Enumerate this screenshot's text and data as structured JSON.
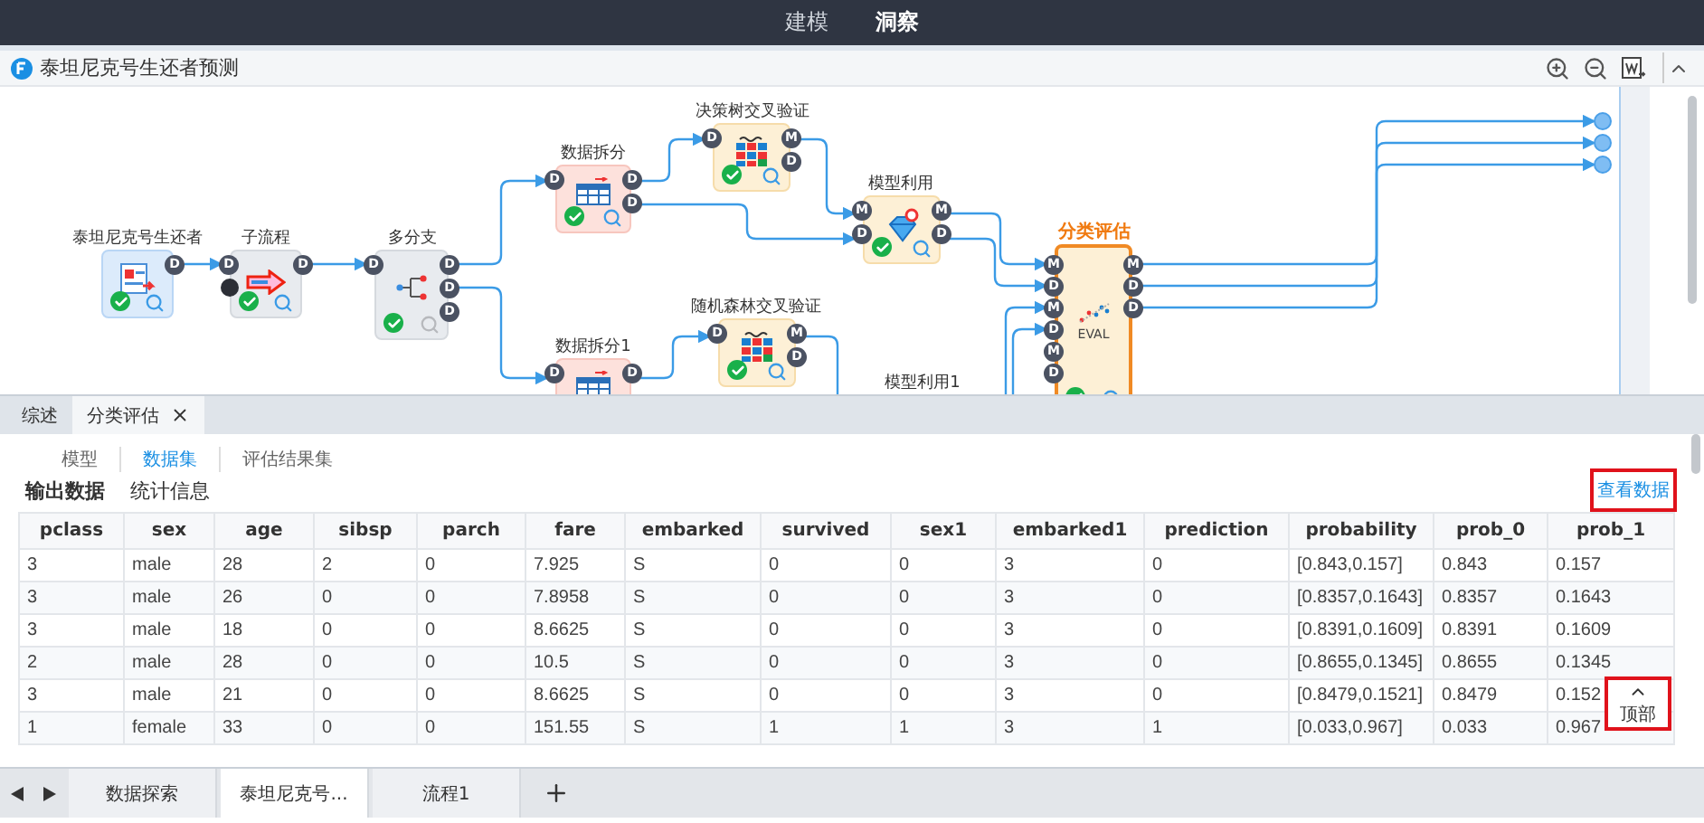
{
  "top_nav": {
    "tabs": [
      {
        "label": "建模",
        "selected": false
      },
      {
        "label": "洞察",
        "selected": true
      }
    ]
  },
  "workflow": {
    "title": "泰坦尼克号生还者预测",
    "nodes": [
      {
        "label": "泰坦尼克号生还者",
        "kind": "source",
        "selected": false,
        "outputs": [
          "D"
        ],
        "done": true,
        "preview": true
      },
      {
        "label": "子流程",
        "kind": "subflow",
        "selected": false,
        "inputs": [
          "D"
        ],
        "outputs": [
          "D"
        ],
        "extra_dot": true,
        "done": true,
        "preview": true
      },
      {
        "label": "多分支",
        "kind": "branch",
        "selected": false,
        "inputs": [
          "D"
        ],
        "outputs": [
          "D",
          "D",
          "D"
        ],
        "done": true,
        "preview": false
      },
      {
        "label": "数据拆分",
        "kind": "split",
        "selected": false,
        "inputs": [
          "D"
        ],
        "outputs": [
          "D",
          "D"
        ],
        "done": true,
        "preview": true
      },
      {
        "label": "数据拆分1",
        "kind": "split",
        "selected": false,
        "inputs": [
          "D"
        ],
        "outputs": [
          "D"
        ]
      },
      {
        "label": "决策树交叉验证",
        "kind": "crossval",
        "selected": false,
        "inputs": [
          "D"
        ],
        "outputs": [
          "M",
          "D"
        ],
        "done": true,
        "preview": true
      },
      {
        "label": "随机森林交叉验证",
        "kind": "crossval",
        "selected": false,
        "inputs": [
          "D"
        ],
        "outputs": [
          "M",
          "D"
        ],
        "done": true,
        "preview": true
      },
      {
        "label": "模型利用",
        "kind": "apply",
        "selected": false,
        "inputs": [
          "M",
          "D"
        ],
        "outputs": [
          "M",
          "D"
        ],
        "done": true,
        "preview": true
      },
      {
        "label": "模型利用1",
        "kind": "caption",
        "selected": false
      },
      {
        "label": "分类评估",
        "kind": "eval",
        "badge": "EVAL",
        "selected": true,
        "inputs": [
          "M",
          "D",
          "M",
          "D",
          "M",
          "D"
        ],
        "outputs": [
          "M",
          "D",
          "D"
        ],
        "done": true,
        "preview": true
      }
    ]
  },
  "panel": {
    "tabs": [
      {
        "label": "综述",
        "selected": false,
        "closable": false
      },
      {
        "label": "分类评估",
        "selected": true,
        "closable": true
      }
    ],
    "subtabs": [
      {
        "label": "模型",
        "selected": false
      },
      {
        "label": "数据集",
        "selected": true
      },
      {
        "label": "评估结果集",
        "selected": false
      }
    ],
    "sections": [
      {
        "label": "输出数据",
        "selected": true
      },
      {
        "label": "统计信息",
        "selected": false
      }
    ],
    "view_data_link": "查看数据",
    "table": {
      "columns": [
        "pclass",
        "sex",
        "age",
        "sibsp",
        "parch",
        "fare",
        "embarked",
        "survived",
        "sex1",
        "embarked1",
        "prediction",
        "probability",
        "prob_0",
        "prob_1"
      ],
      "rows": [
        [
          "3",
          "male",
          "28",
          "2",
          "0",
          "7.925",
          "S",
          "0",
          "0",
          "3",
          "0",
          "[0.843,0.157]",
          "0.843",
          "0.157"
        ],
        [
          "3",
          "male",
          "26",
          "0",
          "0",
          "7.8958",
          "S",
          "0",
          "0",
          "3",
          "0",
          "[0.8357,0.1643]",
          "0.8357",
          "0.1643"
        ],
        [
          "3",
          "male",
          "18",
          "0",
          "0",
          "8.6625",
          "S",
          "0",
          "0",
          "3",
          "0",
          "[0.8391,0.1609]",
          "0.8391",
          "0.1609"
        ],
        [
          "2",
          "male",
          "28",
          "0",
          "0",
          "10.5",
          "S",
          "0",
          "0",
          "3",
          "0",
          "[0.8655,0.1345]",
          "0.8655",
          "0.1345"
        ],
        [
          "3",
          "male",
          "21",
          "0",
          "0",
          "8.6625",
          "S",
          "0",
          "0",
          "3",
          "0",
          "[0.8479,0.1521]",
          "0.8479",
          "0.152"
        ],
        [
          "1",
          "female",
          "33",
          "0",
          "0",
          "151.55",
          "S",
          "1",
          "1",
          "3",
          "1",
          "[0.033,0.967]",
          "0.033",
          "0.967"
        ]
      ]
    },
    "back_to_top": "顶部"
  },
  "bottom_tabs": [
    {
      "label": "数据探索",
      "selected": false
    },
    {
      "label": "泰坦尼克号...",
      "selected": true
    },
    {
      "label": "流程1",
      "selected": false
    }
  ]
}
